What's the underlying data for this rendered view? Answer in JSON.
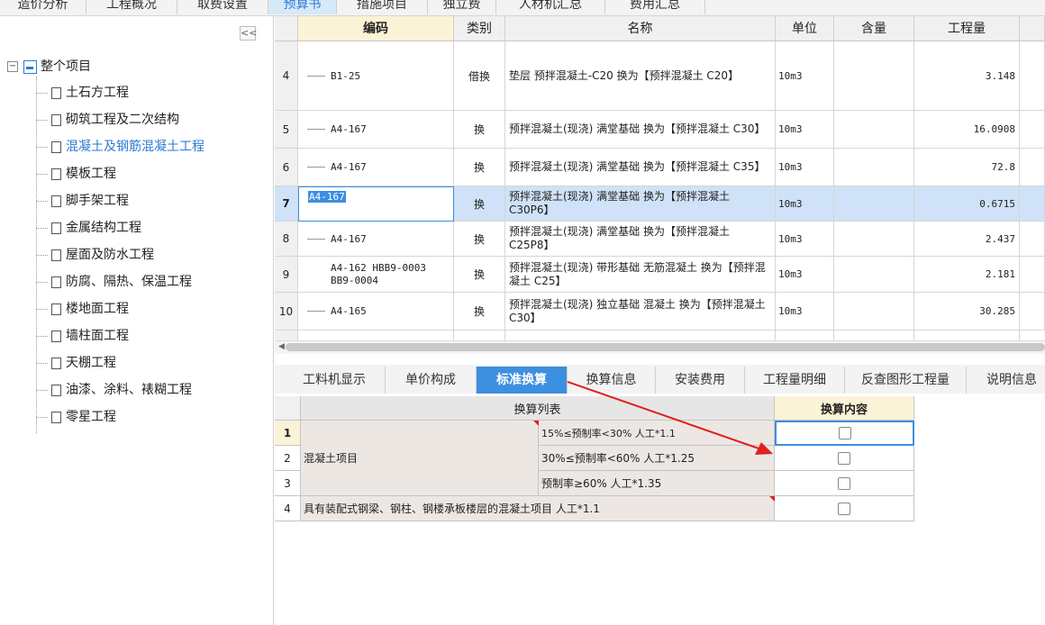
{
  "top_tabs": [
    "造价分析",
    "工程概况",
    "取费设置",
    "预算书",
    "措施项目",
    "独立费",
    "人材机汇总",
    "费用汇总"
  ],
  "left_panel": {
    "collapse_label": "<<",
    "root": "整个项目",
    "items": [
      "土石方工程",
      "砌筑工程及二次结构",
      "混凝土及钢筋混凝土工程",
      "模板工程",
      "脚手架工程",
      "金属结构工程",
      "屋面及防水工程",
      "防腐、隔热、保温工程",
      "楼地面工程",
      "墙柱面工程",
      "天棚工程",
      "油漆、涂料、裱糊工程",
      "零星工程"
    ],
    "selected_item": "混凝土及钢筋混凝土工程"
  },
  "grid": {
    "headers": [
      "编码",
      "类别",
      "名称",
      "单位",
      "含量",
      "工程量"
    ],
    "rows": [
      {
        "num": "4",
        "code": "B1-25",
        "type": "借换",
        "name": "垫层 预拌混凝土-C20  换为【预拌混凝土 C20】",
        "unit": "10m3",
        "qty": "3.148"
      },
      {
        "num": "5",
        "code": "A4-167",
        "type": "换",
        "name": "预拌混凝土(现浇) 满堂基础  换为【预拌混凝土 C30】",
        "unit": "10m3",
        "qty": "16.0908"
      },
      {
        "num": "6",
        "code": "A4-167",
        "type": "换",
        "name": "预拌混凝土(现浇) 满堂基础   换为【预拌混凝土 C35】",
        "unit": "10m3",
        "qty": "72.8"
      },
      {
        "num": "7",
        "code": "A4-167",
        "type": "换",
        "name": "预拌混凝土(现浇) 满堂基础  换为【预拌混凝土 C30P6】",
        "unit": "10m3",
        "qty": "0.6715"
      },
      {
        "num": "8",
        "code": "A4-167",
        "type": "换",
        "name": "预拌混凝土(现浇) 满堂基础  换为【预拌混凝土 C25P8】",
        "unit": "10m3",
        "qty": "2.437"
      },
      {
        "num": "9",
        "code": "A4-162 HBB9-0003 BB9-0004",
        "type": "换",
        "name": "预拌混凝土(现浇) 带形基础 无筋混凝土 换为【预拌混凝土 C25】",
        "unit": "10m3",
        "qty": "2.181"
      },
      {
        "num": "10",
        "code": "A4-165",
        "type": "换",
        "name": "预拌混凝土(现浇) 独立基础 混凝土  换为【预拌混凝土 C30】",
        "unit": "10m3",
        "qty": "30.285"
      }
    ],
    "selected_row": "7"
  },
  "sub_tabs": [
    "工料机显示",
    "单价构成",
    "标准换算",
    "换算信息",
    "安装费用",
    "工程量明细",
    "反查图形工程量",
    "说明信息"
  ],
  "active_sub_tab": "标准换算",
  "conversion": {
    "header_list": "换算列表",
    "header_content": "换算内容",
    "row_nums": [
      "1",
      "2",
      "3",
      "4"
    ],
    "group_label": "混凝土项目",
    "options": [
      "15%≤预制率<30% 人工*1.1",
      "30%≤预制率<60% 人工*1.25",
      "预制率≥60% 人工*1.35"
    ],
    "row4_label": "具有装配式钢梁、钢柱、钢楼承板楼层的混凝土项目 人工*1.1"
  },
  "colors": {
    "accent": "#3d8fe0",
    "selection": "#cfe2f7",
    "arrow": "#e02020"
  }
}
